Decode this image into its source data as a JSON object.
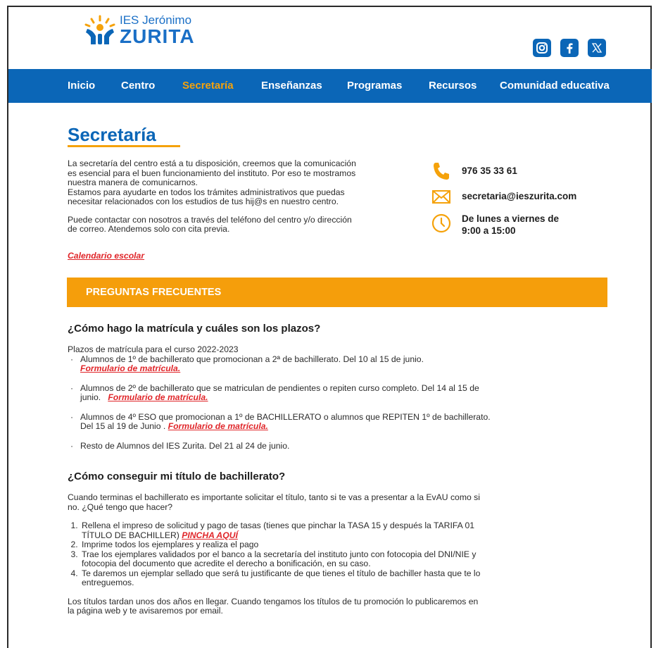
{
  "brand": {
    "name_top": "IES Jerónimo",
    "name_bottom": "ZURITA"
  },
  "colors": {
    "primary": "#0b66b7",
    "accent": "#f5a20b",
    "link": "#e0262a"
  },
  "socials": [
    {
      "icon": "instagram-icon"
    },
    {
      "icon": "facebook-icon"
    },
    {
      "icon": "x-icon"
    }
  ],
  "nav": {
    "items": [
      {
        "label": "Inicio"
      },
      {
        "label": "Centro"
      },
      {
        "label": "Secretaría",
        "active": true
      },
      {
        "label": "Enseñanzas"
      },
      {
        "label": "Programas"
      },
      {
        "label": "Recursos"
      },
      {
        "label": "Comunidad educativa"
      }
    ]
  },
  "page": {
    "title": "Secretaría",
    "intro": {
      "line1": "La secretaría del centro está a tu disposición, creemos que la comunicación",
      "line2": "es esencial para el buen funcionamiento del instituto. Por eso te mostramos",
      "line3": "nuestra manera de comunicarnos.",
      "line4": "Estamos para ayudarte en todos los trámites administrativos que puedas",
      "line5": "necesitar relacionados con los estudios de tus hij@s en nuestro centro.",
      "line6": "Puede contactar con nosotros a través del teléfono del centro  y/o dirección",
      "line7": "de correo. Atendemos solo con cita previa."
    },
    "calendar_link": "Calendario escolar"
  },
  "contact": {
    "phone": "976 35 33 61",
    "email": "secretaria@ieszurita.com",
    "hours_line1": "De lunes a viernes de",
    "hours_line2": "9:00 a 15:00"
  },
  "faq": {
    "banner": "PREGUNTAS FRECUENTES",
    "q1": {
      "title": "¿Cómo hago la matrícula y cuáles son los plazos?",
      "intro": "Plazos de matrícula para el curso 2022-2023",
      "b1_text": "Alumnos de 1º de bachillerato que promocionan a 2ª de bachillerato. Del 10 al 15 de junio.",
      "b1_link": "Formulario de matrícula.",
      "b2_text_a": "Alumnos de 2º de bachillerato que se matriculan de pendientes o repiten curso completo. Del 14 al 15 de",
      "b2_text_b": "junio.",
      "b2_link": "Formulario de matrícula.",
      "b3_text_a": "Alumnos de 4º ESO que promocionan a 1º de BACHILLERATO o alumnos que REPITEN 1º de bachillerato.",
      "b3_text_b": "Del 15  al 19 de Junio .",
      "b3_link": "Formulario de matrícula.",
      "b4_text": "Resto de Alumnos del IES Zurita. Del 21 al 24 de junio."
    },
    "q2": {
      "title": "¿Cómo conseguir mi título de bachillerato?",
      "intro_a": "Cuando terminas el bachillerato es importante solicitar el título, tanto si te vas a presentar a la EvAU como si",
      "intro_b": "no. ¿Qué tengo que hacer?",
      "s1_a": "Rellena el impreso de solicitud y pago de tasas (tienes que pinchar la TASA 15 y después la TARIFA 01",
      "s1_b": "TÍTULO DE BACHILLER)",
      "s1_link": "PINCHA AQUÍ",
      "s2": "Imprime todos los ejemplares y realiza el pago",
      "s3_a": "Trae los ejemplares validados por el banco a la secretaría del instituto junto con fotocopia del DNI/NIE y",
      "s3_b": "fotocopia del documento que acredite el derecho a bonificación, en su caso.",
      "s4_a": "Te daremos un ejemplar sellado que será tu justificante de que tienes el título de bachiller hasta que te lo",
      "s4_b": "entreguemos.",
      "outro_a": "Los títulos tardan unos dos años en llegar. Cuando tengamos los títulos de tu promoción lo publicaremos en",
      "outro_b": "la página web y te avisaremos por email."
    }
  }
}
